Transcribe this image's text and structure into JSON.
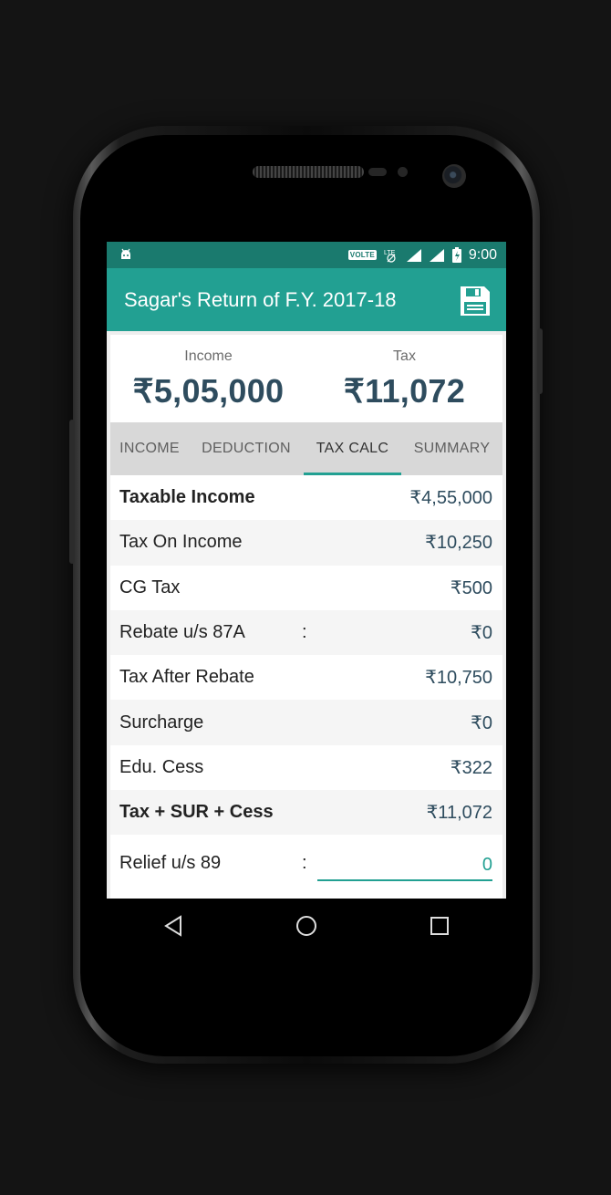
{
  "status_bar": {
    "time": "9:00",
    "volte": "VOLTE",
    "icons": [
      "android-icon",
      "volte-icon",
      "lte-icon",
      "signal-icon",
      "signal-icon",
      "battery-icon"
    ]
  },
  "app_bar": {
    "title": "Sagar's Return of F.Y. 2017-18",
    "action_icon": "save-icon"
  },
  "summary": {
    "income_label": "Income",
    "income_value": "₹5,05,000",
    "tax_label": "Tax",
    "tax_value": "₹11,072"
  },
  "tabs": [
    {
      "label": "INCOME",
      "active": false
    },
    {
      "label": "DEDUCTION",
      "active": false
    },
    {
      "label": "TAX CALC",
      "active": true
    },
    {
      "label": "SUMMARY",
      "active": false
    }
  ],
  "rows": [
    {
      "label": "Taxable Income",
      "value": "₹4,55,000",
      "bold": true
    },
    {
      "label": "Tax On Income",
      "value": "₹10,250"
    },
    {
      "label": "CG Tax",
      "value": "₹500"
    },
    {
      "label": "Rebate u/s 87A",
      "colon": ":",
      "value": "₹0"
    },
    {
      "label": "Tax After Rebate",
      "value": "₹10,750"
    },
    {
      "label": "Surcharge",
      "value": "₹0"
    },
    {
      "label": "Edu. Cess",
      "value": "₹322"
    },
    {
      "label": "Tax + SUR + Cess",
      "value": "₹11,072",
      "bold": true
    }
  ],
  "relief": {
    "label": "Relief u/s 89",
    "colon": ":",
    "value": "0"
  },
  "nav": [
    "back-icon",
    "home-icon",
    "recents-icon"
  ],
  "colors": {
    "status_bar": "#1a7a6e",
    "app_bar": "#22a092",
    "accent": "#22a092",
    "value_text": "#2e4c5e"
  }
}
